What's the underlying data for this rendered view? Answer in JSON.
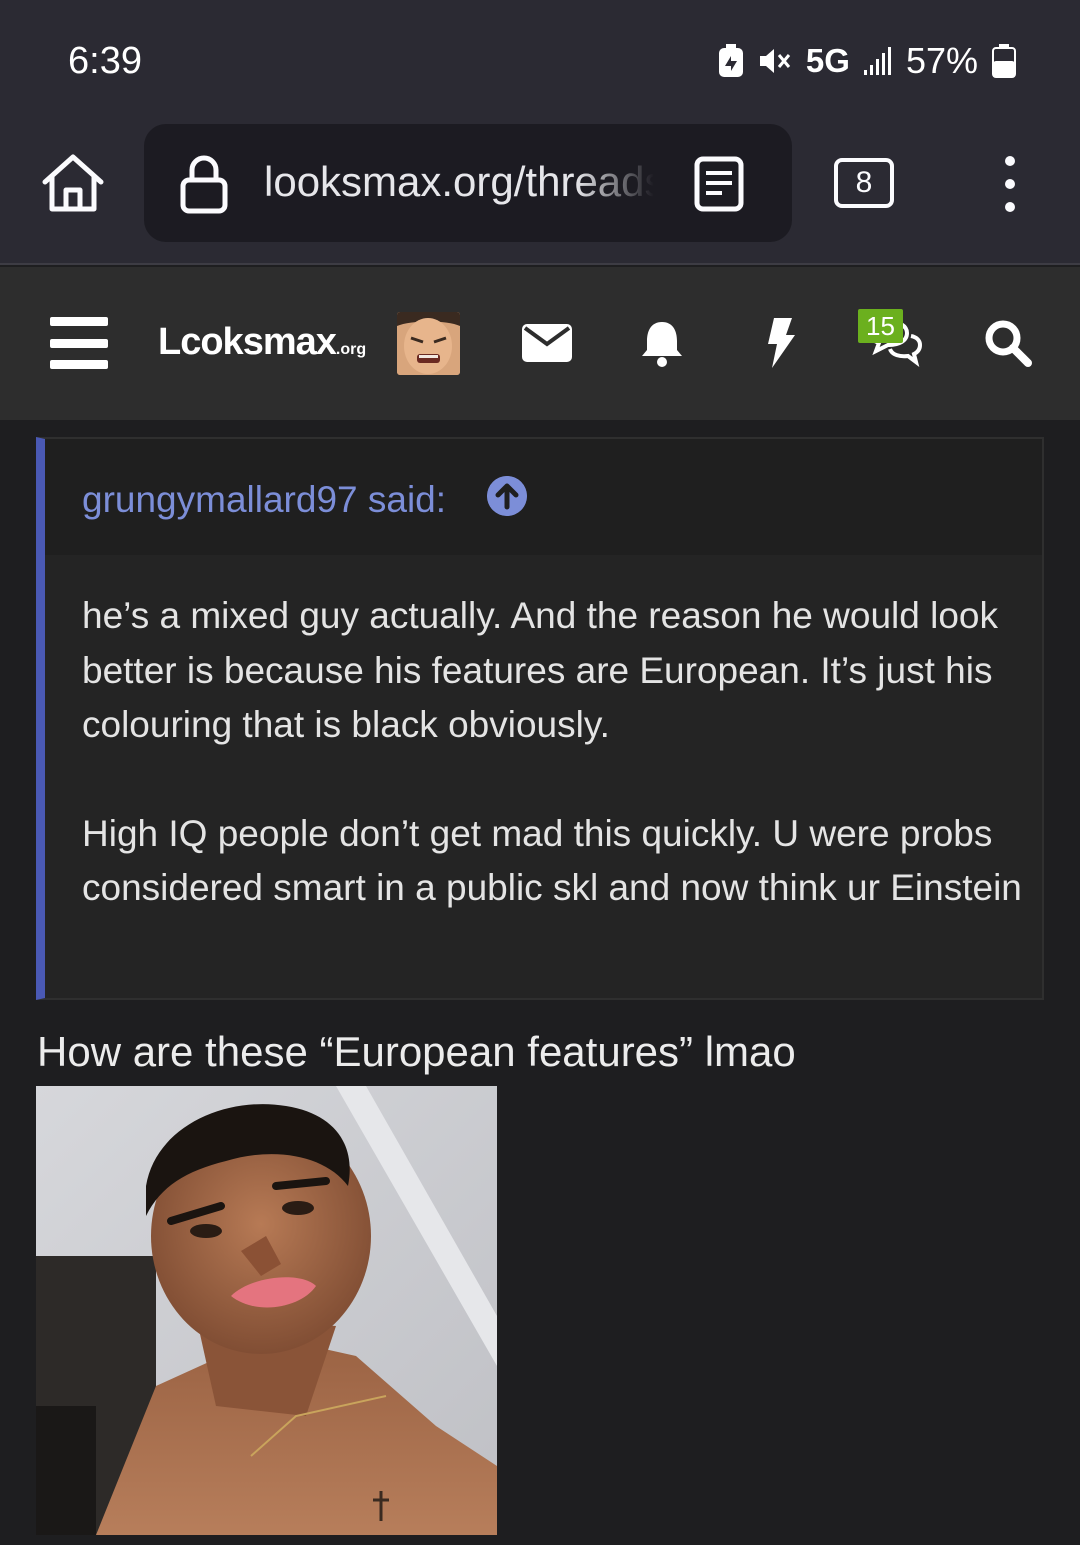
{
  "status_bar": {
    "time": "6:39",
    "network": "5G",
    "battery": "57%"
  },
  "browser": {
    "url": "looksmax.org/threads",
    "tab_count": "8"
  },
  "site_header": {
    "logo_main": "Lcoksmax",
    "logo_suffix": ".org",
    "conversations_badge": "15"
  },
  "quote": {
    "author": "grungymallard97 said:",
    "paragraphs": [
      "he’s a mixed guy actually. And the reason he would look better is because his features are European. It’s just his colouring that is black obviously.",
      "High IQ people don’t get mad this quickly. U were probs considered smart in a public skl and now think ur Einstein"
    ]
  },
  "post": {
    "text": "How are these “European features” lmao"
  },
  "colors": {
    "accent": "#4a59b4",
    "quote_author": "#7c8ed8",
    "badge": "#6bb01e",
    "chrome": "#2b2a33"
  }
}
